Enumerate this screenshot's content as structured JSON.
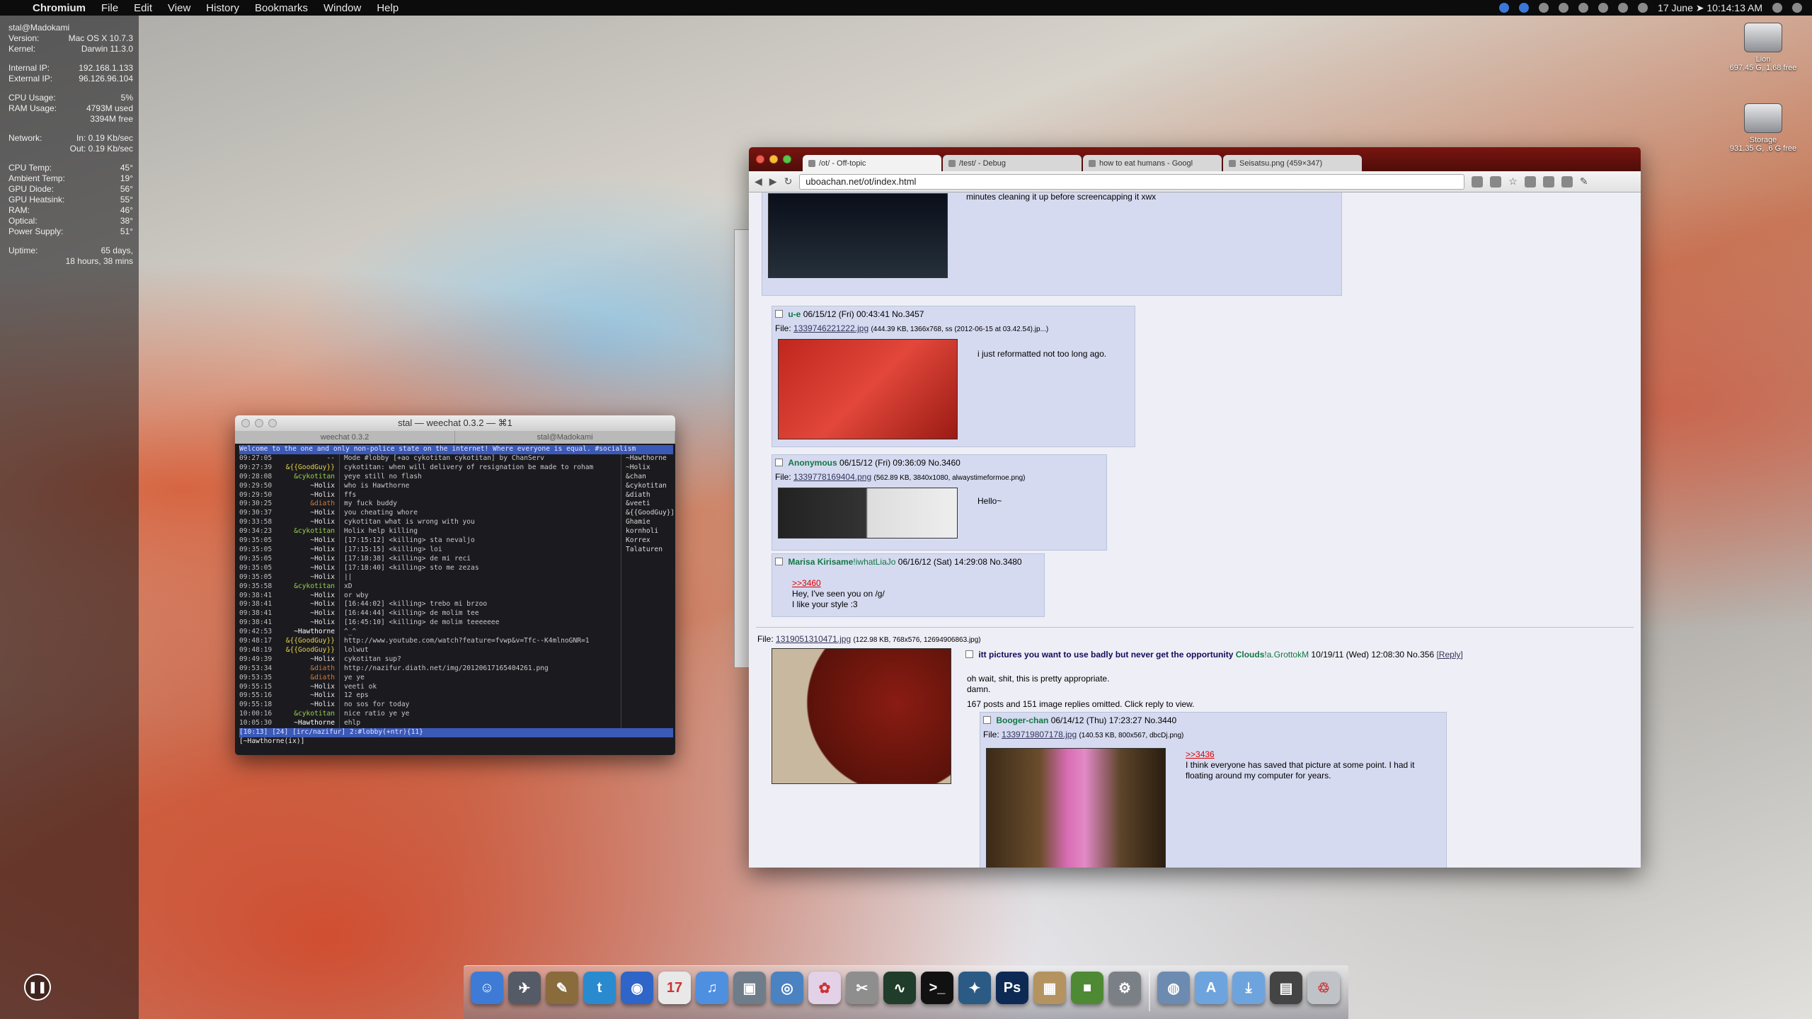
{
  "menubar": {
    "apple": "",
    "app": "Chromium",
    "items": [
      "File",
      "Edit",
      "View",
      "History",
      "Bookmarks",
      "Window",
      "Help"
    ],
    "clock": "17 June ➤ 10:14:13 AM"
  },
  "stats": {
    "host": "stal@Madokami",
    "version_label": "Version:",
    "version": "Mac OS X 10.7.3",
    "kernel_label": "Kernel:",
    "kernel": "Darwin 11.3.0",
    "internal_label": "Internal IP:",
    "internal": "192.168.1.133",
    "external_label": "External IP:",
    "external": "96.126.96.104",
    "cpu_label": "CPU Usage:",
    "cpu": "5%",
    "ram_label": "RAM Usage:",
    "ram_used": "4793M used",
    "ram_free": "3394M free",
    "net_label": "Network:",
    "net_in": "In: 0.19 Kb/sec",
    "net_out": "Out: 0.19 Kb/sec",
    "temps": [
      {
        "label": "CPU Temp:",
        "value": "45°"
      },
      {
        "label": "Ambient Temp:",
        "value": "19°"
      },
      {
        "label": "GPU Diode:",
        "value": "56°"
      },
      {
        "label": "GPU Heatsink:",
        "value": "55°"
      },
      {
        "label": "RAM:",
        "value": "46°"
      },
      {
        "label": "Optical:",
        "value": "38°"
      },
      {
        "label": "Power Supply:",
        "value": "51°"
      }
    ],
    "uptime_label": "Uptime:",
    "uptime_1": "65 days,",
    "uptime_2": "18 hours, 38 mins"
  },
  "drives": [
    {
      "name": "Lion",
      "info": "697.45 G, 1.68 free"
    },
    {
      "name": "Storage",
      "info": "931.35 G, .6 G free"
    }
  ],
  "terminal": {
    "title": "stal — weechat 0.3.2 — ⌘1",
    "tabs": [
      "weechat 0.3.2",
      "stal@Madokami"
    ],
    "topic": "Welcome to the one and only non-police state on the internet! Where everyone is equal. #socialism",
    "lines": [
      {
        "t": "09:27:05",
        "n": "--",
        "m": "Mode #lobby [+ao cykotitan cykotitan] by ChanServ",
        "nl": "~Hawthorne"
      },
      {
        "t": "09:27:39",
        "n": "&{{GoodGuy}}",
        "m": "cykotitan: when will delivery of resignation be made to roham",
        "nl": "~Holix"
      },
      {
        "t": "09:28:08",
        "n": "&cykotitan",
        "m": "yeye still no flash",
        "nl": "&chan"
      },
      {
        "t": "09:29:50",
        "n": "~Holix",
        "m": "who is Hawthorne",
        "nl": "&cykotitan"
      },
      {
        "t": "09:29:50",
        "n": "~Holix",
        "m": "ffs",
        "nl": "&diath"
      },
      {
        "t": "09:30:25",
        "n": "&diath",
        "m": "my fuck buddy",
        "nl": "&veeti"
      },
      {
        "t": "09:30:37",
        "n": "~Holix",
        "m": "you cheating whore",
        "nl": "&{{GoodGuy}}"
      },
      {
        "t": "09:33:58",
        "n": "~Holix",
        "m": "cykotitan what is wrong with you",
        "nl": "Ghamie"
      },
      {
        "t": "09:34:23",
        "n": "&cykotitan",
        "m": "Holix help killing",
        "nl": "kornholi"
      },
      {
        "t": "09:35:05",
        "n": "~Holix",
        "m": "[17:15:12] <killing> sta nevaljo",
        "nl": "Korrex"
      },
      {
        "t": "09:35:05",
        "n": "~Holix",
        "m": "[17:15:15] <killing> loi",
        "nl": "Talaturen"
      },
      {
        "t": "09:35:05",
        "n": "~Holix",
        "m": "[17:18:38] <killing> de mi reci",
        "nl": ""
      },
      {
        "t": "09:35:05",
        "n": "~Holix",
        "m": "[17:18:40] <killing> sto me zezas",
        "nl": ""
      },
      {
        "t": "09:35:05",
        "n": "~Holix",
        "m": "||",
        "nl": ""
      },
      {
        "t": "09:35:58",
        "n": "&cykotitan",
        "m": "xD",
        "nl": ""
      },
      {
        "t": "09:38:41",
        "n": "~Holix",
        "m": "or wby",
        "nl": ""
      },
      {
        "t": "09:38:41",
        "n": "~Holix",
        "m": "[16:44:02] <killing> trebo mi brzoo",
        "nl": ""
      },
      {
        "t": "09:38:41",
        "n": "~Holix",
        "m": "[16:44:44] <killing> de molim tee",
        "nl": ""
      },
      {
        "t": "09:38:41",
        "n": "~Holix",
        "m": "[16:45:10] <killing> de molim teeeeeee",
        "nl": ""
      },
      {
        "t": "09:42:53",
        "n": "~Hawthorne",
        "m": "^_^",
        "nl": ""
      },
      {
        "t": "09:48:17",
        "n": "&{{GoodGuy}}",
        "m": "http://www.youtube.com/watch?feature=fvwp&v=Tfc--K4mlnoGNR=1",
        "nl": ""
      },
      {
        "t": "09:48:19",
        "n": "&{{GoodGuy}}",
        "m": "lolwut",
        "nl": ""
      },
      {
        "t": "09:49:39",
        "n": "~Holix",
        "m": "cykotitan sup?",
        "nl": ""
      },
      {
        "t": "09:53:34",
        "n": "&diath",
        "m": "http://nazifur.diath.net/img/20120617165404261.png",
        "nl": ""
      },
      {
        "t": "09:53:35",
        "n": "&diath",
        "m": "ye ye",
        "nl": ""
      },
      {
        "t": "09:55:15",
        "n": "~Holix",
        "m": "veeti ok",
        "nl": ""
      },
      {
        "t": "09:55:16",
        "n": "~Holix",
        "m": "12 eps",
        "nl": ""
      },
      {
        "t": "09:55:18",
        "n": "~Holix",
        "m": "no sos for today",
        "nl": ""
      },
      {
        "t": "10:00:16",
        "n": "&cykotitan",
        "m": "nice ratio ye ye",
        "nl": ""
      },
      {
        "t": "10:05:30",
        "n": "~Hawthorne",
        "m": "ehlp",
        "nl": ""
      }
    ],
    "status": "[10:13] [24] [irc/nazifur] 2:#lobby(+ntr){11}",
    "input": "[~Hawthorne(ix)]"
  },
  "browser": {
    "tabs": [
      "/ot/ - Off-topic",
      "/test/ - Debug",
      "how to eat humans - Googl",
      "Seisatsu.png (459×347)"
    ],
    "url": "uboachan.net/ot/index.html",
    "top_text": "minutes cleaning it up before screencapping it xwx",
    "posts": [
      {
        "name": "u-e",
        "date": "06/15/12 (Fri) 00:43:41",
        "no": "No.3457",
        "file_label": "File:",
        "file": "1339746221222.jpg",
        "meta": "(444.39 KB, 1366x768, ss (2012-06-15 at 03.42.54).jp...)",
        "text": "i just reformatted not too long ago."
      },
      {
        "name": "Anonymous",
        "date": "06/15/12 (Fri) 09:36:09",
        "no": "No.3460",
        "file_label": "File:",
        "file": "1339778169404.png",
        "meta": "(562.89 KB, 3840x1080, alwaystimeformoe.png)",
        "text": "Hello~"
      },
      {
        "name": "Marisa Kirisame",
        "trip": "!iwhatLiaJo",
        "date": "06/16/12 (Sat) 14:29:08",
        "no": "No.3480",
        "quote": ">>3460",
        "text1": "Hey, I've seen you on /g/",
        "text2": "I like your style :3"
      }
    ],
    "thread": {
      "file_label": "File:",
      "file": "1319051310471.jpg",
      "meta": "(122.98 KB, 768x576, 12694906863.jpg)",
      "subject": "itt pictures you want to use badly but never get the opportunity",
      "name": "Clouds",
      "trip": "!a.GrottokM",
      "date": "10/19/11 (Wed) 12:08:30",
      "no": "No.356",
      "reply": "[Reply]",
      "text1": "oh wait, shit, this is pretty appropriate.",
      "text2": "damn.",
      "omitted": "167 posts and 151 image replies omitted. Click reply to view."
    },
    "last_reply": {
      "name": "Booger-chan",
      "date": "06/14/12 (Thu) 17:23:27",
      "no": "No.3440",
      "file_label": "File:",
      "file": "1339719807178.jpg",
      "meta": "(140.53 KB, 800x567, dbcDj.png)",
      "quote": ">>3436",
      "text": "I think everyone has saved that picture at some point. I had it floating around my computer for years."
    }
  },
  "dock": {
    "items": [
      {
        "icon": "finder-icon",
        "color": "#3d7bd6",
        "glyph": "☺"
      },
      {
        "icon": "launchpad-icon",
        "color": "#555b66",
        "glyph": "✈"
      },
      {
        "icon": "preview-icon",
        "color": "#8a6b3c",
        "glyph": "✎"
      },
      {
        "icon": "twitter-client-icon",
        "color": "#2a8ad0",
        "glyph": "t"
      },
      {
        "icon": "chromium-icon",
        "color": "#2f64c8",
        "glyph": "◉"
      },
      {
        "icon": "ical-icon",
        "color": "#e8e8e8",
        "glyph": "17"
      },
      {
        "icon": "itunes-icon",
        "color": "#4f8fe0",
        "glyph": "♫"
      },
      {
        "icon": "iphoto-icon",
        "color": "#6f7d8a",
        "glyph": "▣"
      },
      {
        "icon": "safari-icon",
        "color": "#4a82c2",
        "glyph": "◎"
      },
      {
        "icon": "sakura-icon",
        "color": "#e3d1e8",
        "glyph": "✿"
      },
      {
        "icon": "script-editor-icon",
        "color": "#8e8e8e",
        "glyph": "✂"
      },
      {
        "icon": "activity-monitor-icon",
        "color": "#1f3d2a",
        "glyph": "∿"
      },
      {
        "icon": "terminal-icon",
        "color": "#111111",
        "glyph": ">_"
      },
      {
        "icon": "bird-icon",
        "color": "#2b5a85",
        "glyph": "✦"
      },
      {
        "icon": "photoshop-icon",
        "color": "#0d2a55",
        "glyph": "Ps"
      },
      {
        "icon": "package-icon",
        "color": "#b59360",
        "glyph": "▦"
      },
      {
        "icon": "minecraft-icon",
        "color": "#4e8a33",
        "glyph": "■"
      },
      {
        "icon": "system-preferences-icon",
        "color": "#7b7f86",
        "glyph": "⚙"
      },
      {
        "icon": "network-icon",
        "color": "#6d8bb0",
        "glyph": "◍"
      },
      {
        "icon": "applications-folder-icon",
        "color": "#6ea4de",
        "glyph": "A"
      },
      {
        "icon": "downloads-folder-icon",
        "color": "#6ea4de",
        "glyph": "⤓"
      },
      {
        "icon": "screenshots-stack-icon",
        "color": "#444444",
        "glyph": "▤"
      },
      {
        "icon": "trash-icon",
        "color": "#bfc3c8",
        "glyph": "♲"
      }
    ]
  }
}
